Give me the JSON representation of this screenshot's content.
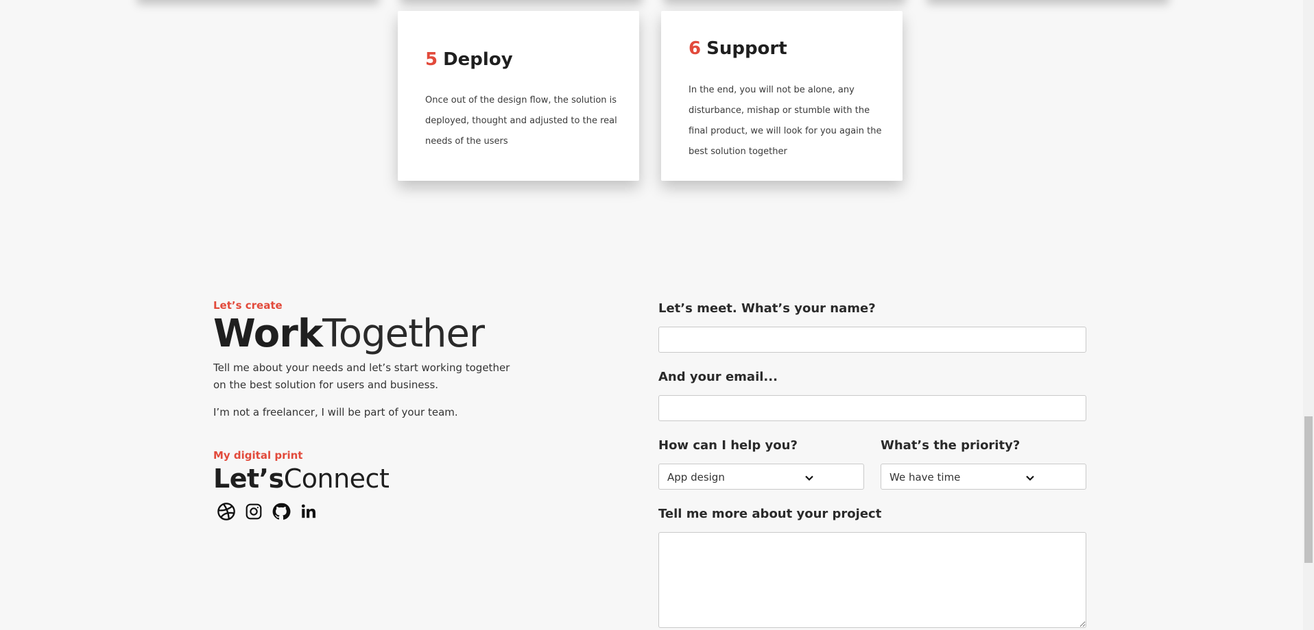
{
  "process_steps": [
    {
      "number": "5",
      "title": "Deploy",
      "description": "Once out of the design flow, the solution is deployed, thought and adjusted to the real needs of the users"
    },
    {
      "number": "6",
      "title": "Support",
      "description": "In the end, you will not be alone, any disturbance, mishap or stumble with the final product, we will look for you again the best solution together"
    }
  ],
  "work_together": {
    "eyebrow": "Let’s create",
    "title_bold": "Work",
    "title_light": "Together",
    "intro": "Tell me about your needs and let’s start working together on the best solution for users and business.",
    "intro2": "I’m not a freelancer, I will be part of your team."
  },
  "connect": {
    "eyebrow": "My digital print",
    "title_bold": "Let’s",
    "title_light": "Connect",
    "socials": [
      "dribbble-icon",
      "instagram-icon",
      "github-icon",
      "linkedin-icon"
    ]
  },
  "form": {
    "name_label": "Let’s meet. What’s your name?",
    "name_value": "",
    "email_label": "And your email...",
    "email_value": "",
    "help_label": "How can I help you?",
    "help_selected": "App design",
    "priority_label": "What’s the priority?",
    "priority_selected": "We have time",
    "project_label": "Tell me more about your project",
    "project_value": ""
  },
  "colors": {
    "accent": "#e24a3b",
    "background": "#f7f7f7",
    "card": "#ffffff"
  }
}
